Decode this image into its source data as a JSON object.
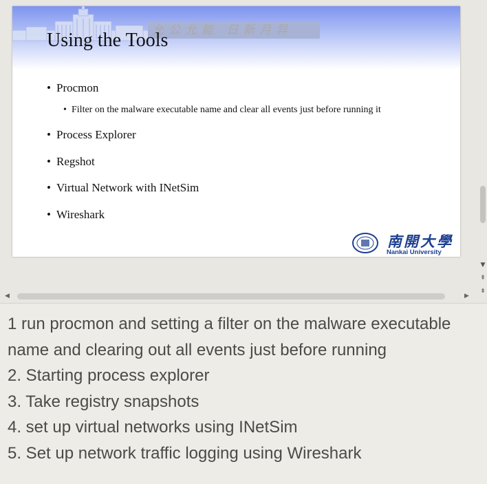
{
  "slide": {
    "header_motto": "允公允能 日新月异",
    "title": "Using the Tools",
    "bullets": [
      {
        "text": "Procmon",
        "level": 1
      },
      {
        "text": "Filter on the malware executable name and clear all events just before running it",
        "level": 2
      },
      {
        "text": "Process Explorer",
        "level": 1
      },
      {
        "text": "Regshot",
        "level": 1
      },
      {
        "text": "Virtual Network with INetSim",
        "level": 1
      },
      {
        "text": "Wireshark",
        "level": 1
      }
    ],
    "logo_cn": "南開大學",
    "logo_en": "Nankai University",
    "bullet_glyph": "•"
  },
  "scroll": {
    "up_icon": "▲",
    "down_icon": "▼",
    "prev_slide_icon": "⇞",
    "next_slide_icon": "⇟",
    "left_icon": "◀",
    "right_icon": "▶"
  },
  "notes": {
    "lines": [
      "1 run procmon and setting a filter on the malware executable",
      "name and clearing out all events just before running",
      "2. Starting process explorer",
      "3. Take registry snapshots",
      "4. set up virtual networks using INetSim",
      "5. Set up network traffic logging using Wireshark"
    ]
  },
  "colors": {
    "header_top": "#7f94ef",
    "logo_blue": "#1d3f8f",
    "notes_text": "#4c4a47"
  }
}
